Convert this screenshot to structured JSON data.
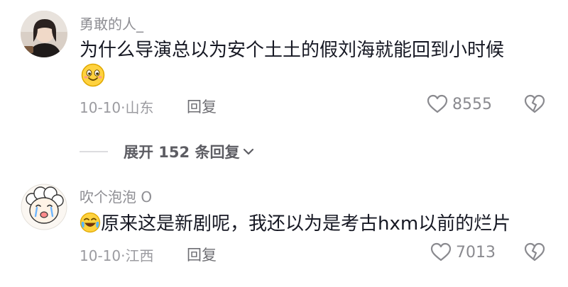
{
  "comments": [
    {
      "username": "勇敢的人_",
      "text": "为什么导演总以为安个土土的假刘海就能回到小时候",
      "emoji": "smiling-face-emoji",
      "date": "10-10",
      "location": "山东",
      "reply_label": "回复",
      "likes": "8555"
    },
    {
      "username": "吹个泡泡 O",
      "emoji": "crying-laughing-emoji",
      "text": "原来这是新剧呢，我还以为是考古hxm以前的烂片",
      "date": "10-10",
      "location": "江西",
      "reply_label": "回复",
      "likes": "7013"
    }
  ],
  "expand_replies": {
    "label": "展开 152 条回复"
  },
  "colors": {
    "username": "#8e8e93",
    "text": "#161823",
    "meta": "#9b9ba0",
    "divider": "#dcdcdf"
  },
  "icons": {
    "like": "heart-outline-icon",
    "dislike": "broken-heart-icon",
    "expand": "chevron-down-icon"
  }
}
